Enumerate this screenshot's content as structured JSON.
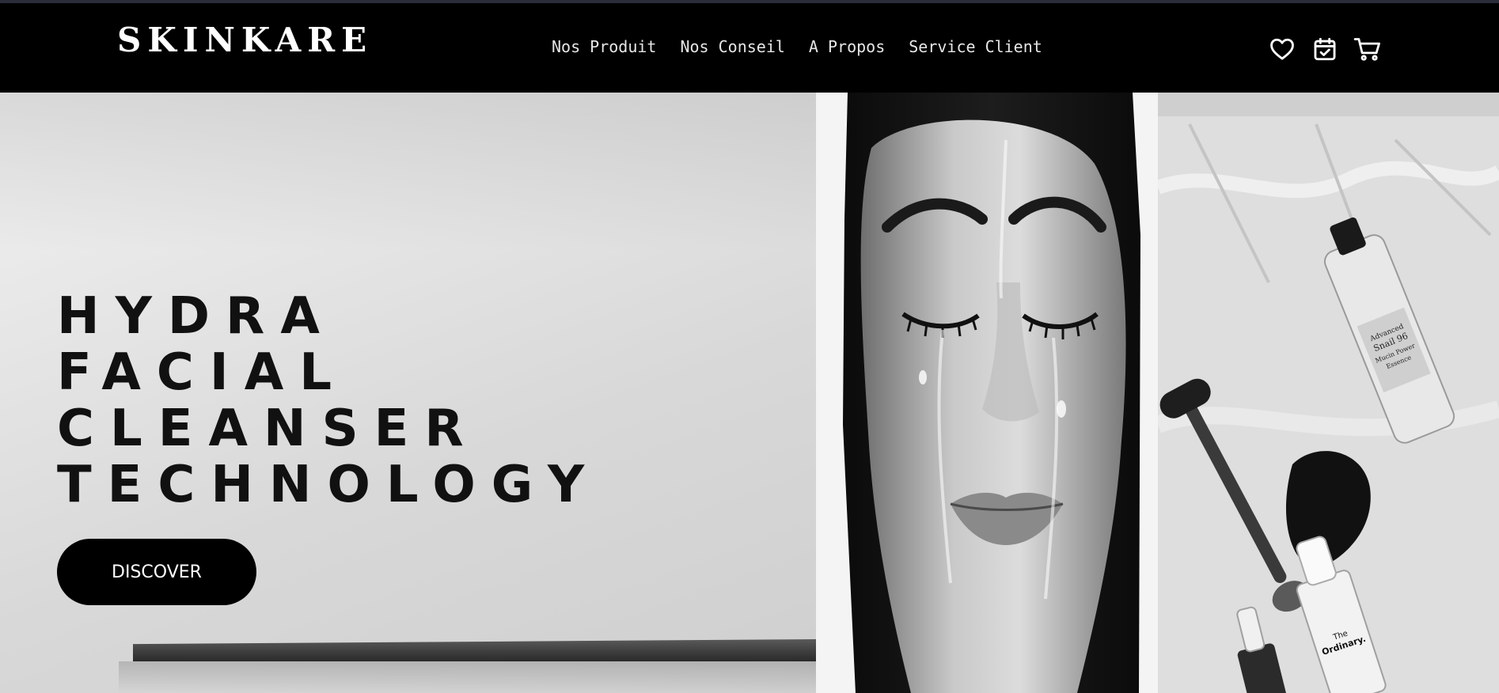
{
  "header": {
    "logo": "SKINKARE",
    "nav": [
      {
        "label": "Nos Produit"
      },
      {
        "label": "Nos Conseil"
      },
      {
        "label": "A Propos"
      },
      {
        "label": "Service Client"
      }
    ],
    "icons": [
      "heart-icon",
      "calendar-check-icon",
      "cart-icon"
    ]
  },
  "hero": {
    "title_lines": [
      "HYDRA",
      "FACIAL",
      "CLEANSER",
      "TECHNOLOGY"
    ],
    "cta": "DISCOVER"
  },
  "gallery": {
    "images": [
      "woman-face-water-photo",
      "skincare-products-photo"
    ],
    "product_labels": [
      "Advanced Snail 96 Mucin Power Essence",
      "The Ordinary."
    ]
  },
  "colors": {
    "nav_background": "#000000",
    "nav_text": "#e6e6e6",
    "button_background": "#000000",
    "button_text": "#ffffff",
    "hero_text": "#111111"
  }
}
